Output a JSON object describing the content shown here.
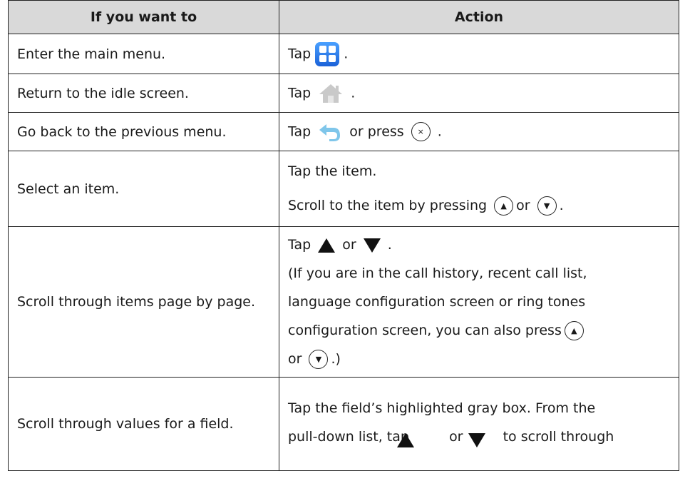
{
  "header": {
    "col1": "If you want to",
    "col2": "Action"
  },
  "rows": [
    {
      "want": "Enter the main menu.",
      "tap": "Tap",
      "after": "."
    },
    {
      "want": "Return to the idle screen.",
      "tap": "Tap",
      "after": "."
    },
    {
      "want": "Go back to the previous menu.",
      "tap": "Tap",
      "or_press": "or press",
      "key": "×",
      "after": "."
    },
    {
      "want": "Select an item.",
      "line1": "Tap the item.",
      "line2_pre": "Scroll to the item by pressing",
      "or": "or",
      "after": "."
    },
    {
      "want": "Scroll through items page by page.",
      "tap": "Tap",
      "or": "or",
      "after": ".",
      "para1": "(If you are in the call history, recent call list,",
      "para2": "language configuration screen or ring tones",
      "para3": "configuration screen, you can also press",
      "para4_or": "or",
      "para4_end": ".)"
    },
    {
      "want": "Scroll through values for a field.",
      "line1": "Tap the field’s highlighted gray box. From the",
      "line2_a": "pull-down list, tap",
      "line2_or": "or",
      "line2_b": "to scroll through"
    }
  ],
  "icons": {
    "menu": "main-menu-icon",
    "home": "home-icon",
    "back": "back-arrow-icon",
    "up_key": "up-key-icon",
    "down_key": "down-key-icon"
  }
}
